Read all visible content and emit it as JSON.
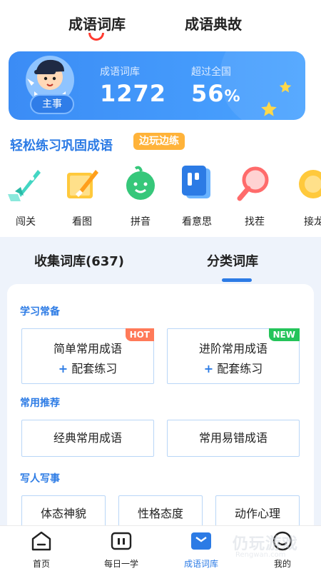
{
  "top_tabs": {
    "library": "成语词库",
    "stories": "成语典故"
  },
  "stats": {
    "role": "主事",
    "library_label": "成语词库",
    "library_count": "1272",
    "rank_label": "超过全国",
    "rank_value": "56",
    "rank_unit": "%"
  },
  "practice": {
    "title": "轻松练习巩固成语",
    "badge": "边玩边练"
  },
  "modes": [
    {
      "label": "闯关",
      "icon": "rocket-icon"
    },
    {
      "label": "看图",
      "icon": "paint-brush-icon"
    },
    {
      "label": "拼音",
      "icon": "pinyin-face-icon"
    },
    {
      "label": "看意思",
      "icon": "meaning-card-icon"
    },
    {
      "label": "找茬",
      "icon": "magnifier-icon"
    },
    {
      "label": "接龙",
      "icon": "chain-icon"
    }
  ],
  "library": {
    "collected_tab": "收集词库(637)",
    "category_tab": "分类词库",
    "sections": [
      {
        "title": "学习常备",
        "items": [
          {
            "label": "简单常用成语",
            "sub_prefix": "+",
            "sub": "配套练习",
            "tag": "HOT"
          },
          {
            "label": "进阶常用成语",
            "sub_prefix": "+",
            "sub": "配套练习",
            "tag": "NEW"
          }
        ]
      },
      {
        "title": "常用推荐",
        "items": [
          {
            "label": "经典常用成语"
          },
          {
            "label": "常用易错成语"
          }
        ]
      },
      {
        "title": "写人写事",
        "items": [
          {
            "label": "体态神貌"
          },
          {
            "label": "性格态度"
          },
          {
            "label": "动作心理"
          }
        ]
      }
    ]
  },
  "bottom_nav": [
    {
      "label": "首页",
      "icon": "home-icon"
    },
    {
      "label": "每日一学",
      "icon": "daily-icon"
    },
    {
      "label": "成语词库",
      "icon": "library-icon",
      "active": true
    },
    {
      "label": "我的",
      "icon": "profile-icon"
    }
  ],
  "watermark": {
    "text": "仍玩游戏",
    "sub": "Rengwan.com"
  },
  "colors": {
    "accent": "#2c7be5",
    "card": "#3b8cf5",
    "hot": "#ff7a59",
    "new": "#24c45a",
    "badge": "#ffb33a"
  }
}
